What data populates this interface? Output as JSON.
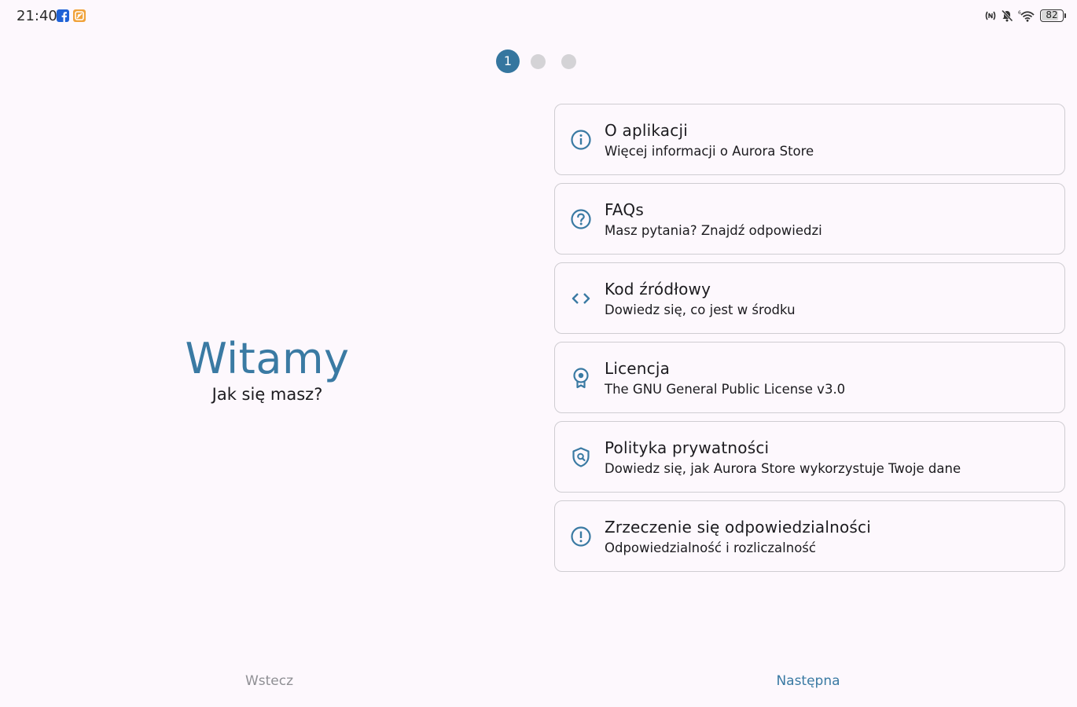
{
  "status_bar": {
    "time": "21:40",
    "battery": "82",
    "battery_level": 0.82,
    "icons": [
      "facebook-icon",
      "notes-app-icon",
      "nfc-icon",
      "mute-icon",
      "wifi-icon",
      "battery-icon"
    ]
  },
  "stepper": {
    "steps": [
      "1",
      "",
      ""
    ],
    "active_index": 0,
    "active_color": "#35769f",
    "inactive_color": "#d4d3d6"
  },
  "welcome": {
    "title": "Witamy",
    "subtitle": "Jak się masz?"
  },
  "cards": [
    {
      "icon": "info-icon",
      "title": "O aplikacji",
      "subtitle": "Więcej informacji o Aurora Store"
    },
    {
      "icon": "help-icon",
      "title": "FAQs",
      "subtitle": "Masz pytania? Znajdź odpowiedzi"
    },
    {
      "icon": "code-icon",
      "title": "Kod źródłowy",
      "subtitle": "Dowiedz się, co jest w środku"
    },
    {
      "icon": "license-icon",
      "title": "Licencja",
      "subtitle": "The GNU General Public License v3.0"
    },
    {
      "icon": "privacy-shield-icon",
      "title": "Polityka prywatności",
      "subtitle": "Dowiedz się, jak Aurora Store wykorzystuje Twoje dane"
    },
    {
      "icon": "warning-icon",
      "title": "Zrzeczenie się odpowiedzialności",
      "subtitle": "Odpowiedzialność i rozliczalność"
    }
  ],
  "nav": {
    "back_label": "Wstecz",
    "next_label": "Następna"
  },
  "colors": {
    "accent": "#3a7aa3",
    "background": "#fdf8fd",
    "card_border": "#cfcdd2",
    "disabled_text": "#8f8f94"
  }
}
